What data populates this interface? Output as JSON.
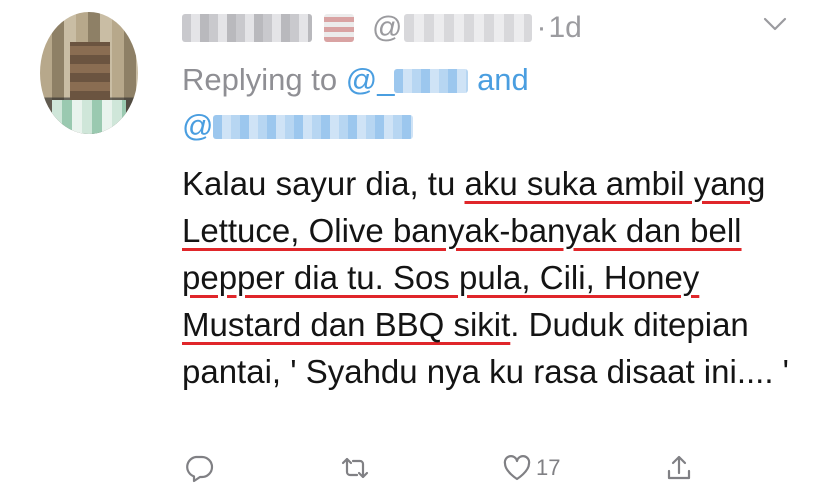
{
  "tweet": {
    "at_symbol": "@",
    "separator": "·",
    "timestamp": "1d",
    "replying_to_prefix": "Replying to",
    "replying_mention_prefix": "@_",
    "replying_and": "and",
    "replying_second_prefix": "@",
    "body_plain_1": "Kalau sayur dia, tu ",
    "body_underlined": "aku suka ambil yang Lettuce, Olive banyak-banyak dan bell pepper dia tu. Sos pula, Cili, Honey Mustard dan BBQ sikit",
    "body_plain_2": ". Duduk ditepian pantai, ' Syahdu nya ku rasa disaat ini.... '",
    "like_count": "17"
  },
  "icons": {
    "reply": "comment-icon",
    "retweet": "retweet-icon",
    "like": "heart-icon",
    "share": "share-icon",
    "menu": "chevron-down-icon"
  },
  "colors": {
    "link": "#4a9ee0",
    "meta": "#9b9b9f",
    "underline": "#e0262a",
    "text": "#141414"
  }
}
